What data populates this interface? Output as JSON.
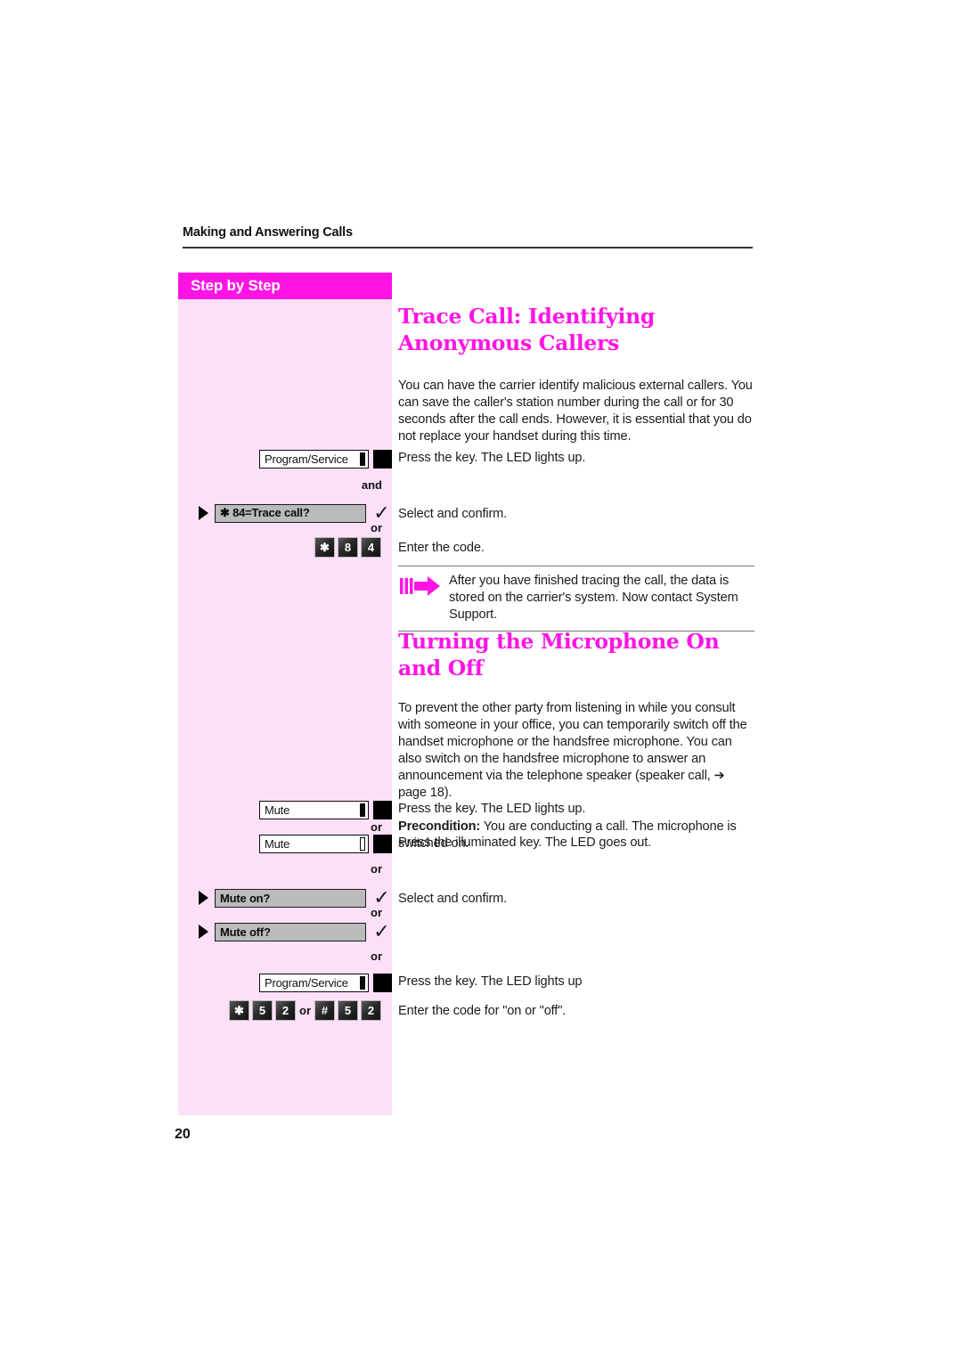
{
  "page": {
    "running_head": "Making and Answering Calls",
    "folio": "20",
    "sidebar_title": "Step by Step",
    "colors": {
      "accent": "#ff14e4",
      "sidebar_fill": "#fde0f8",
      "option_bar": "#bbbbbb"
    }
  },
  "sections": [
    {
      "id": "trace-call",
      "title": "Trace Call: Identifying Anonymous Callers",
      "intro": "You can have the carrier identify malicious external callers. You can save the caller's station number during the call or for 30 seconds after the call ends. However, it is essential that you do not replace your handset during this time.",
      "note": {
        "icon": "arrow-note-icon",
        "text": "After you have finished tracing the call, the data is stored on the carrier's system. Now contact System Support."
      },
      "steps": [
        {
          "type": "function-key",
          "key_label": "Program/Service",
          "led": "on",
          "instruction": "Press the key. The LED lights up.",
          "conjunction_after": "and"
        },
        {
          "type": "menu-option",
          "option_label": "✱ 84=Trace call?",
          "confirm": "✓",
          "instruction": "Select and confirm.",
          "conjunction_after": "or"
        },
        {
          "type": "keypad",
          "keys": [
            "✱",
            "8",
            "4"
          ],
          "instruction": "Enter the code."
        }
      ]
    },
    {
      "id": "microphone",
      "title": "Turning the Microphone On and Off",
      "intro": "To prevent the other party from listening in while you consult with someone in your office, you can temporarily switch off the handset microphone or the handsfree microphone. You can also switch on the handsfree microphone to answer an announcement via the telephone speaker (speaker call, ➔ page 18).",
      "precondition_label": "Precondition:",
      "precondition_text": " You are conducting a call. The microphone is switched on.",
      "steps": [
        {
          "type": "function-key",
          "key_label": "Mute",
          "led": "off",
          "instruction": "Press the key. The LED lights up.",
          "conjunction_after": "or"
        },
        {
          "type": "function-key",
          "key_label": "Mute",
          "led": "lit",
          "instruction": "Press the illuminated key. The LED goes out.",
          "conjunction_after": "or"
        },
        {
          "type": "menu-option",
          "option_label": "Mute on?",
          "confirm": "✓",
          "instruction": "Select and confirm.",
          "conjunction_after": "or"
        },
        {
          "type": "menu-option",
          "option_label": "Mute off?",
          "confirm": "✓",
          "instruction": "",
          "conjunction_after": "or"
        },
        {
          "type": "function-key",
          "key_label": "Program/Service",
          "led": "on",
          "instruction": "Press the key. The LED lights up"
        },
        {
          "type": "keypad-pair",
          "keys_a": [
            "✱",
            "5",
            "2"
          ],
          "join": "or",
          "keys_b": [
            "#",
            "5",
            "2"
          ],
          "instruction": "Enter the code for \"on or \"off\"."
        }
      ]
    }
  ]
}
